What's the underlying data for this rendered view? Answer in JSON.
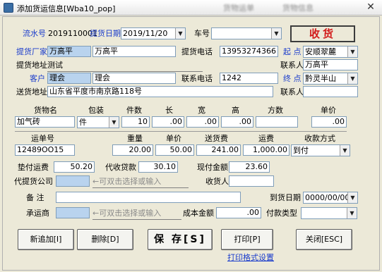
{
  "window": {
    "title": "添加货运信息[Wba10_pop]",
    "ghost_labels": [
      "货物运单",
      "货物信息"
    ],
    "close_glyph": "✕"
  },
  "header": {
    "serial_label": "流水号",
    "serial_value": "2019110001",
    "pickup_date_label": "提货日期",
    "pickup_date_value": "2019/11/20",
    "vehicle_label": "车号",
    "vehicle_value": "",
    "receipt_label": "收货"
  },
  "shipper": {
    "factory_label": "提货厂家",
    "factory_code": "万高平",
    "factory_name": "万高平",
    "phone_label": "提货电话",
    "phone_value": "13953274366",
    "start_label": "起 点",
    "start_value": "安顺翠麓",
    "address_label": "提货地址",
    "address_value": "测试",
    "contact_label": "联系人",
    "contact_value": "万高平"
  },
  "consignee": {
    "customer_label": "客户",
    "customer_code": "理会",
    "customer_name": "理会",
    "phone_label": "联系电话",
    "phone_value": "1242",
    "end_label": "终 点",
    "end_value": "黔灵半山",
    "address_label": "送货地址",
    "address_value": "山东省平度市南京路118号",
    "contact_label": "联系人",
    "contact_value": ""
  },
  "goods": {
    "headers": {
      "name": "货物名",
      "package": "包装",
      "count": "件数",
      "length": "长",
      "width": "宽",
      "height": "高",
      "volume": "方数",
      "unit_price": "单价"
    },
    "row": {
      "name": "加气砖",
      "package": "件",
      "count": "10",
      "length": ".00",
      "width": ".00",
      "height": ".00",
      "volume": "",
      "unit_price": ".00"
    }
  },
  "waybill": {
    "headers": {
      "number": "运单号",
      "weight": "重量",
      "unit_price": "单价",
      "delivery_fee": "送货费",
      "freight": "运费",
      "payment_method": "收款方式"
    },
    "row": {
      "number": "12489OO15",
      "weight": "20.00",
      "unit_price": "50.00",
      "delivery_fee": "241.00",
      "freight": "1,000.00",
      "payment_method": "到付"
    }
  },
  "fees": {
    "advance_label": "垫付运费",
    "advance_value": "50.20",
    "collect_label": "代收贷款",
    "collect_value": "30.10",
    "cash_label": "现付金额",
    "cash_value": "23.60"
  },
  "agent": {
    "company_label": "代提货公司",
    "company_hint": "←可双击选择或输入",
    "receiver_label": "收货人",
    "receiver_value": ""
  },
  "remarks": {
    "label": "备 注",
    "value": "",
    "arrival_label": "到货日期",
    "arrival_value": "0000/00/00"
  },
  "carrier": {
    "label": "承运商",
    "hint": "←可双击选择或输入",
    "cost_label": "成本金额",
    "cost_value": ".00",
    "pay_type_label": "付款类型",
    "pay_type_value": ""
  },
  "actions": {
    "new": "新追加[I]",
    "delete": "删除[D]",
    "save": "保 存[S]",
    "print": "打印[P]",
    "close": "关闭[ESC]",
    "print_settings": "打印格式设置"
  },
  "colors": {
    "label_blue": "#1a3ccc",
    "receipt_red": "#d21a1a",
    "highlight": "#b9d3ee"
  }
}
